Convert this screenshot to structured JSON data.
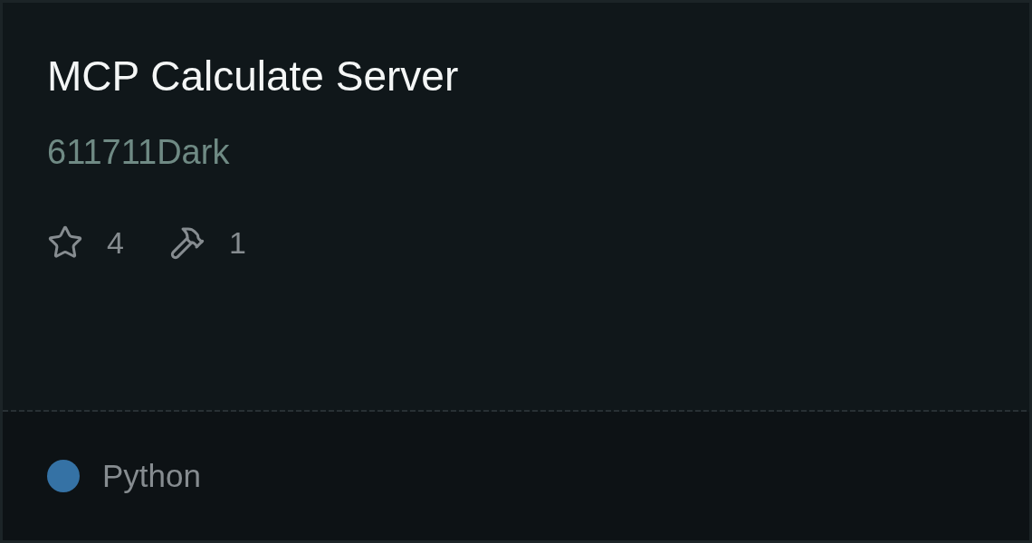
{
  "card": {
    "title": "MCP Calculate Server",
    "author": "611711Dark",
    "stats": [
      {
        "kind": "stars",
        "value": "4"
      },
      {
        "kind": "tools",
        "value": "1"
      }
    ],
    "language": {
      "name": "Python",
      "color": "#3572a5"
    }
  }
}
